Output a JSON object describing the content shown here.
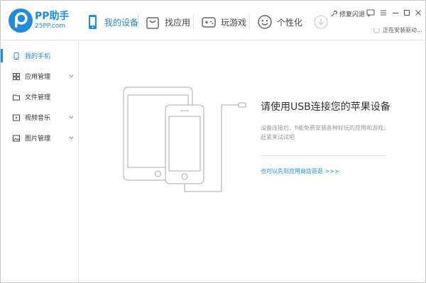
{
  "app": {
    "name": "PP助手",
    "url": "25PP.com",
    "brand_color": "#1c8be0"
  },
  "nav": {
    "tabs": [
      {
        "label": "我的设备",
        "icon": "phone-icon",
        "active": true
      },
      {
        "label": "找应用",
        "icon": "shopping-bag-icon",
        "active": false
      },
      {
        "label": "玩游戏",
        "icon": "gamepad-icon",
        "active": false
      },
      {
        "label": "个性化",
        "icon": "smiley-icon",
        "active": false
      }
    ]
  },
  "header": {
    "feedback_label": "修复闪退",
    "connection_status": "正在安装驱动..."
  },
  "sidebar": {
    "items": [
      {
        "label": "我的手机",
        "icon": "phone-icon",
        "active": true,
        "expandable": false
      },
      {
        "label": "应用管理",
        "icon": "apps-grid-icon",
        "active": false,
        "expandable": true
      },
      {
        "label": "文件管理",
        "icon": "folder-icon",
        "active": false,
        "expandable": false
      },
      {
        "label": "视频音乐",
        "icon": "media-icon",
        "active": false,
        "expandable": true
      },
      {
        "label": "图片管理",
        "icon": "image-icon",
        "active": false,
        "expandable": true
      }
    ]
  },
  "main": {
    "title": "请使用USB连接您的苹果设备",
    "description": "设备连接后，fi能免费安装各种好玩的应用和游戏，赶紧来试试吧",
    "store_link": "也可以先到应用商店逛逛 >>>"
  }
}
